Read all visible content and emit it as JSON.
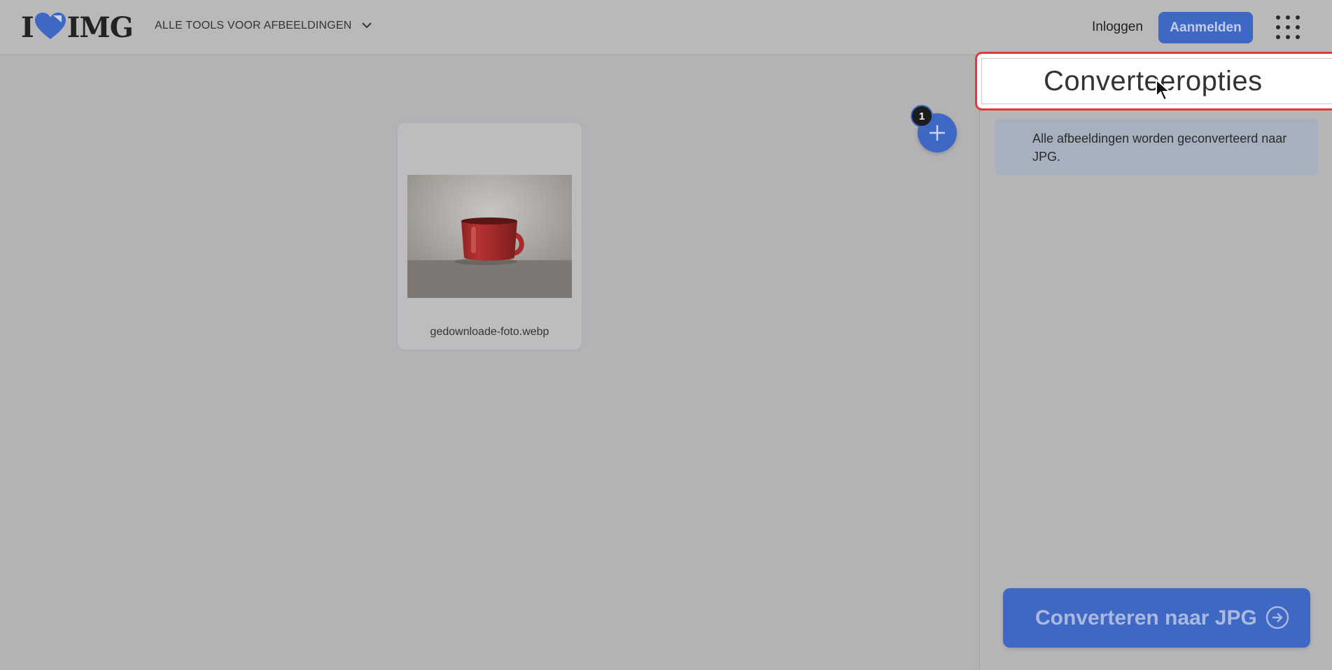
{
  "header": {
    "logo_text_left": "I",
    "logo_text_right": "IMG",
    "tools_menu_label": "ALLE TOOLS VOOR AFBEELDINGEN",
    "login_label": "Inloggen",
    "signup_label": "Aanmelden",
    "apps_icon": "grid-dots-icon"
  },
  "workspace": {
    "files": [
      {
        "name": "gedownloade-foto.webp",
        "thumbnail": "red-mug-photo"
      }
    ],
    "file_count": "1",
    "add_icon": "plus-icon"
  },
  "sidebar": {
    "title": "Converteeropties",
    "info_text": "Alle afbeeldingen worden geconverteerd naar JPG.",
    "convert_button_label": "Converteren naar JPG",
    "convert_icon": "arrow-right-circle-icon"
  },
  "colors": {
    "brand_blue": "#3f67c4",
    "highlight_red": "#e53935",
    "overlay_gray": "#b3b3b6"
  }
}
